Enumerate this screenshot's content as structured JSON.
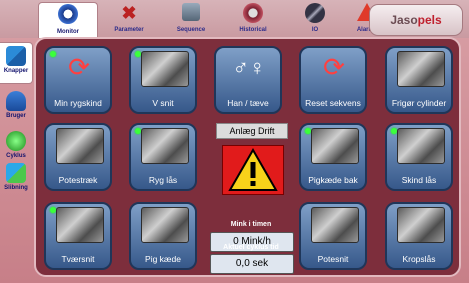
{
  "tabs": [
    {
      "label": "Monitor",
      "icon": "gear-icon",
      "active": true
    },
    {
      "label": "Parameter",
      "icon": "tools-icon",
      "active": false
    },
    {
      "label": "Sequence",
      "icon": "sequence-icon",
      "active": false
    },
    {
      "label": "Historical",
      "icon": "history-icon",
      "active": false
    },
    {
      "label": "IO",
      "icon": "io-icon",
      "active": false
    },
    {
      "label": "Alarms",
      "icon": "alarm-icon",
      "active": false
    }
  ],
  "logo": {
    "text_a": "Jaso",
    "text_b": "pels"
  },
  "sidebar": [
    {
      "label": "Knapper",
      "icon": "arrows-icon",
      "active": true
    },
    {
      "label": "Bruger",
      "icon": "user-icon",
      "active": false
    },
    {
      "label": "Cyklus",
      "icon": "cycle-icon",
      "active": false
    },
    {
      "label": "Slibning",
      "icon": "grinding-icon",
      "active": false
    }
  ],
  "tiles": [
    {
      "label": "Min rygskind",
      "icon": "refresh-icon",
      "active": true
    },
    {
      "label": "V snit",
      "icon": "machine-photo",
      "active": true
    },
    {
      "label": "Han / tæve",
      "icon": "gender-icon",
      "active": false
    },
    {
      "label": "Reset sekvens",
      "icon": "refresh-icon",
      "active": false
    },
    {
      "label": "Frigør cylinder",
      "icon": "machine-photo",
      "active": false
    },
    {
      "label": "Potestræk",
      "icon": "machine-photo",
      "active": false
    },
    {
      "label": "Ryg lås",
      "icon": "machine-photo",
      "active": true
    },
    {
      "label": "Pigkæde bak",
      "icon": "machine-photo",
      "active": true
    },
    {
      "label": "Skind lås",
      "icon": "machine-photo",
      "active": true
    },
    {
      "label": "Tværsnit",
      "icon": "machine-photo",
      "active": true
    },
    {
      "label": "Pig kæde",
      "icon": "machine-photo",
      "active": false
    },
    {
      "label": "Potesnit",
      "icon": "machine-photo",
      "active": false
    },
    {
      "label": "Kropslås",
      "icon": "machine-photo",
      "active": false
    }
  ],
  "status": {
    "text": "Anlæg Drift",
    "warning_color": "#e11b1b"
  },
  "minks_per_hour": {
    "label": "Mink i timen",
    "value": "0  Mink/h"
  },
  "cycle_time": {
    "label": "Aktuel cyklus tid",
    "value": "0,0  sek"
  }
}
